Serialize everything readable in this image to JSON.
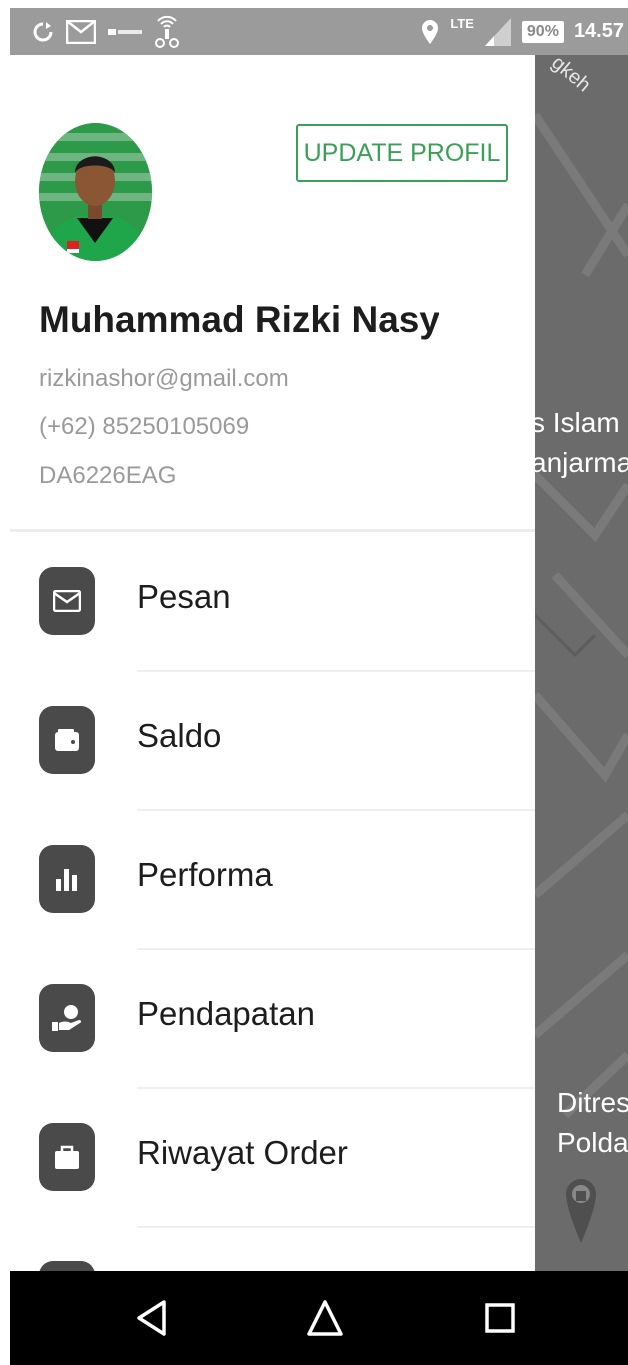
{
  "status_bar": {
    "network_type": "LTE",
    "battery_percent": "90%",
    "time": "14.57",
    "left_icons": [
      "sync-icon",
      "gmail-icon",
      "operator-icon",
      "driver-app-icon"
    ],
    "right_icons": [
      "location-icon",
      "signal-icon"
    ]
  },
  "drawer": {
    "update_button_label": "UPDATE PROFIL",
    "user": {
      "name": "Muhammad Rizki Nasyar",
      "email": "rizkinashor@gmail.com",
      "phone": "(+62) 85250105069",
      "plate": "DA6226EAG"
    },
    "menu": [
      {
        "label": "Pesan",
        "icon": "mail-icon"
      },
      {
        "label": "Saldo",
        "icon": "wallet-icon"
      },
      {
        "label": "Performa",
        "icon": "bar-chart-icon"
      },
      {
        "label": "Pendapatan",
        "icon": "income-icon"
      },
      {
        "label": "Riwayat Order",
        "icon": "briefcase-icon"
      }
    ]
  },
  "map": {
    "labels": [
      "gkeh",
      "s Islam",
      "anjarma",
      "Ditres",
      "Polda"
    ]
  },
  "navigation_bar": {
    "buttons": [
      "back-icon",
      "home-icon",
      "recents-icon"
    ]
  },
  "colors": {
    "accent_green": "#3aa057",
    "status_bar": "#9b9b9b",
    "menu_icon_bg": "#4a4a4a",
    "map_overlay": "#6b6b6b"
  }
}
